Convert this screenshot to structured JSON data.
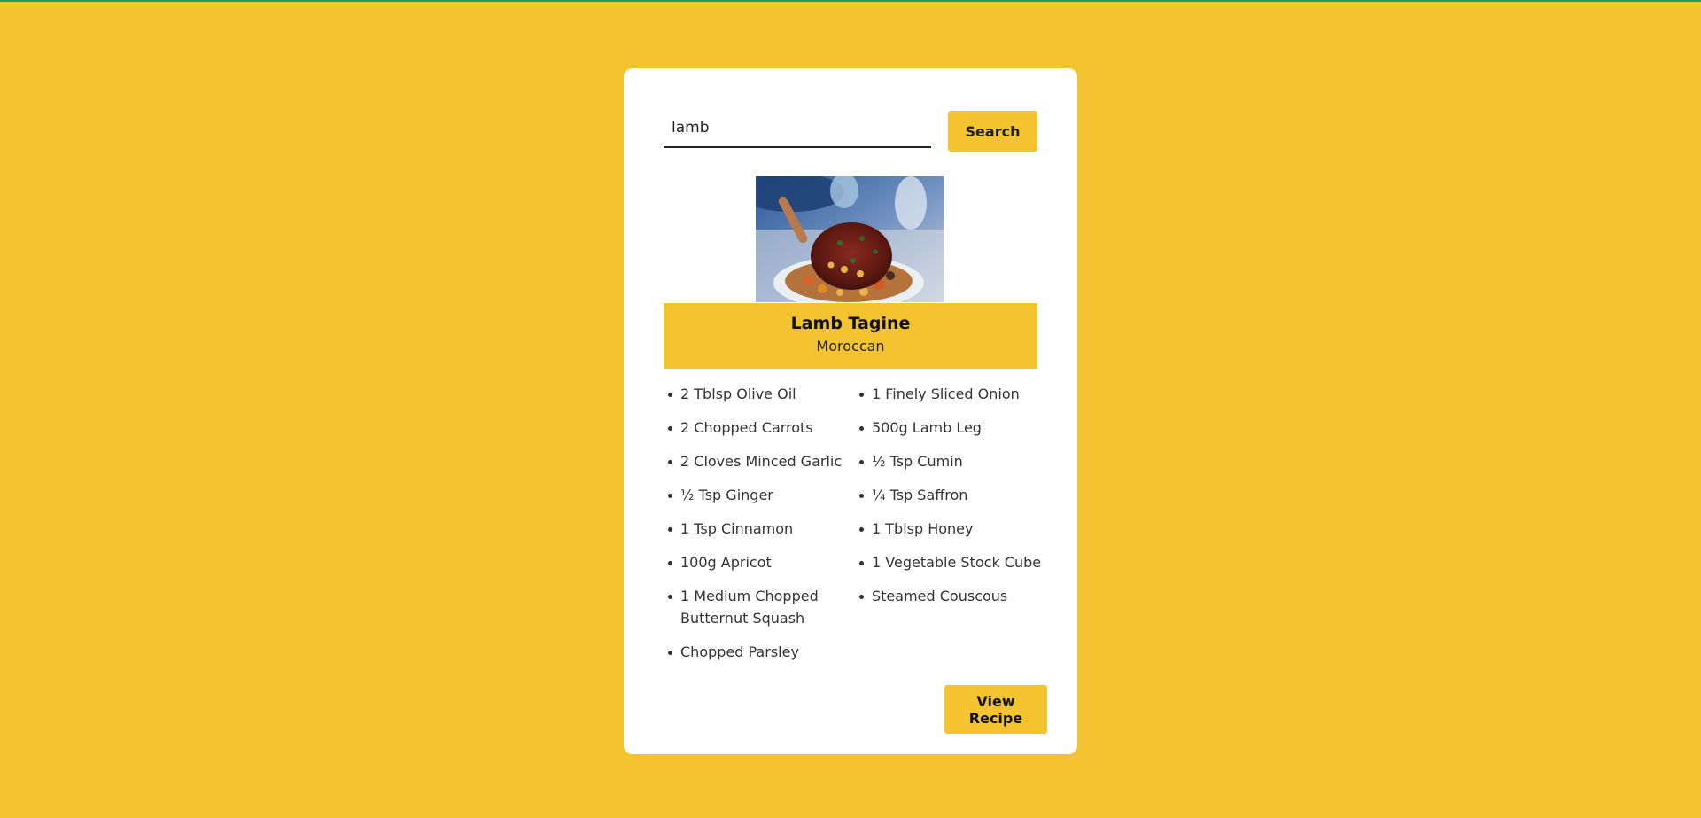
{
  "search": {
    "value": "lamb",
    "button_label": "Search"
  },
  "meal": {
    "image_subject": "lamb-tagine-photo",
    "name": "Lamb Tagine",
    "area": "Moroccan",
    "ingredients": [
      "2 Tblsp Olive Oil",
      "1 Finely Sliced Onion",
      "2 Chopped Carrots",
      "500g Lamb Leg",
      "2 Cloves Minced Garlic",
      "½ Tsp Cumin",
      "½ Tsp Ginger",
      "¼ Tsp Saffron",
      "1 Tsp Cinnamon",
      "1 Tblsp Honey",
      "100g Apricot",
      "1 Vegetable Stock Cube",
      "1 Medium Chopped Butternut Squash",
      "Steamed Couscous",
      "Chopped Parsley"
    ],
    "view_button_label": "View Recipe"
  },
  "colors": {
    "background": "#f4c430",
    "accent": "#f4c430",
    "top_line": "#2e9a5a",
    "card": "#ffffff"
  }
}
